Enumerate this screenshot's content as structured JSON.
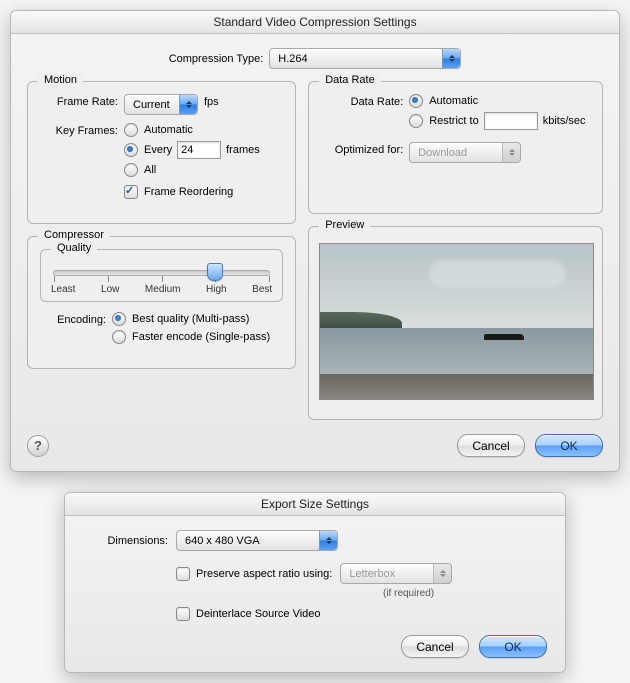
{
  "dialog1": {
    "title": "Standard Video Compression Settings",
    "compression_type_label": "Compression Type:",
    "compression_type_value": "H.264",
    "motion": {
      "legend": "Motion",
      "frame_rate_label": "Frame Rate:",
      "frame_rate_value": "Current",
      "frame_rate_unit": "fps",
      "key_frames_label": "Key Frames:",
      "options": {
        "automatic": "Automatic",
        "every": "Every",
        "every_value": "24",
        "every_unit": "frames",
        "all": "All"
      },
      "frame_reordering": "Frame Reordering"
    },
    "datarate": {
      "legend": "Data Rate",
      "label": "Data Rate:",
      "automatic": "Automatic",
      "restrict": "Restrict to",
      "restrict_value": "",
      "restrict_unit": "kbits/sec",
      "optimized_label": "Optimized for:",
      "optimized_value": "Download"
    },
    "compressor": {
      "legend": "Compressor",
      "quality_legend": "Quality",
      "ticks": [
        "Least",
        "Low",
        "Medium",
        "High",
        "Best"
      ],
      "slider_pos_pct": 75,
      "encoding_label": "Encoding:",
      "best": "Best quality (Multi-pass)",
      "faster": "Faster encode (Single-pass)"
    },
    "preview_legend": "Preview",
    "buttons": {
      "cancel": "Cancel",
      "ok": "OK"
    },
    "help": "?"
  },
  "dialog2": {
    "title": "Export Size Settings",
    "dimensions_label": "Dimensions:",
    "dimensions_value": "640 x 480 VGA",
    "preserve": "Preserve aspect ratio using:",
    "preserve_mode": "Letterbox",
    "if_required": "(if required)",
    "deinterlace": "Deinterlace Source Video",
    "buttons": {
      "cancel": "Cancel",
      "ok": "OK"
    }
  }
}
